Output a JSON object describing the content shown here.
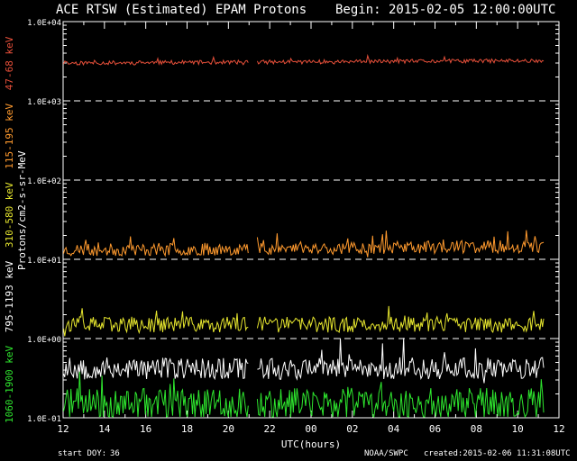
{
  "header": {
    "title": "ACE RTSW (Estimated) EPAM Protons",
    "begin": "Begin: 2015-02-05 12:00:00UTC"
  },
  "footer": {
    "start_doy_label": "start DOY:",
    "start_doy_value": "36",
    "source": "NOAA/SWPC",
    "created": "created:2015-02-06 11:31:08UTC"
  },
  "colors": {
    "background": "#000000",
    "axes": "#ffffff",
    "grid": "#ffffff",
    "ch_47_68": "#e8503a",
    "ch_115_195": "#ff9a2e",
    "ch_310_580": "#e6e62e",
    "ch_795_1193": "#ffffff",
    "ch_1060_1900": "#2ee62e"
  },
  "chart_data": {
    "type": "line",
    "title": "ACE RTSW (Estimated) EPAM Protons",
    "xlabel": "UTC(hours)",
    "ylabel": "Protons/cm2-s-sr-MeV",
    "yscale": "log",
    "ylim": [
      0.1,
      10000
    ],
    "xlim": [
      12,
      36
    ],
    "grid": "dashed horizontal lines at decades",
    "y_tick_labels": [
      "1.0E-01",
      "1.0E+00",
      "1.0E+01",
      "1.0E+02",
      "1.0E+03",
      "1.0E+04"
    ],
    "y_tick_values": [
      0.1,
      1,
      10,
      100,
      1000,
      10000
    ],
    "x_tick_labels": [
      "12",
      "14",
      "16",
      "18",
      "20",
      "22",
      "00",
      "02",
      "04",
      "06",
      "08",
      "10",
      "12"
    ],
    "x_tick_values": [
      12,
      14,
      16,
      18,
      20,
      22,
      24,
      26,
      28,
      30,
      32,
      34,
      36
    ],
    "data_gap": [
      21.0,
      21.4
    ],
    "x_end": 35.3,
    "series": [
      {
        "name": "47-68 keV",
        "color": "#e8503a",
        "baseline": 3000,
        "jitter": 0.025,
        "seed": 11,
        "trend": 0.03
      },
      {
        "name": "115-195 keV",
        "color": "#ff9a2e",
        "baseline": 13,
        "jitter": 0.08,
        "seed": 23,
        "trend": 0.05
      },
      {
        "name": "310-580 keV",
        "color": "#e6e62e",
        "baseline": 1.5,
        "jitter": 0.1,
        "seed": 37,
        "trend": 0.0
      },
      {
        "name": "795-1193 keV",
        "color": "#ffffff",
        "baseline": 0.42,
        "jitter": 0.14,
        "seed": 53,
        "trend": 0.0
      },
      {
        "name": "1060-1900 keV",
        "color": "#2ee62e",
        "baseline": 0.15,
        "jitter": 0.2,
        "seed": 71,
        "trend": 0.0
      }
    ]
  }
}
